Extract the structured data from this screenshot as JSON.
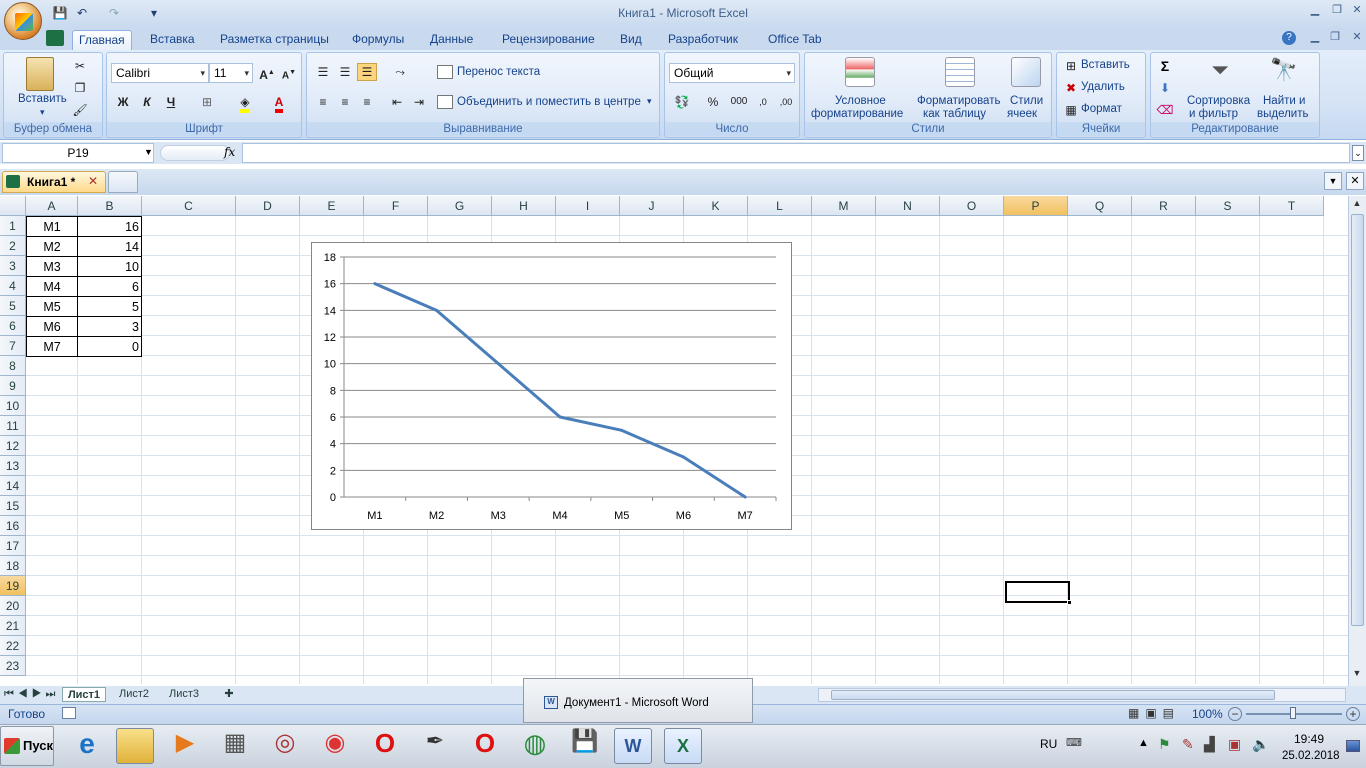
{
  "window": {
    "title": "Книга1 - Microsoft Excel"
  },
  "tabs": [
    "Главная",
    "Вставка",
    "Разметка страницы",
    "Формулы",
    "Данные",
    "Рецензирование",
    "Вид",
    "Разработчик",
    "Office Tab"
  ],
  "ribbon": {
    "clipboard": {
      "label": "Буфер обмена",
      "paste": "Вставить"
    },
    "font": {
      "label": "Шрифт",
      "name": "Calibri",
      "size": "11",
      "bold": "Ж",
      "italic": "К",
      "underline": "Ч"
    },
    "alignment": {
      "label": "Выравнивание",
      "wrap": "Перенос текста",
      "merge": "Объединить и поместить в центре"
    },
    "number": {
      "label": "Число",
      "format": "Общий",
      "percent": "%",
      "thousands": "000",
      "inc_dec": ",0",
      "dec_dec": ",00"
    },
    "styles": {
      "label": "Стили",
      "conditional_1": "Условное",
      "conditional_2": "форматирование",
      "table_1": "Форматировать",
      "table_2": "как таблицу",
      "cell_1": "Стили",
      "cell_2": "ячеек"
    },
    "cells": {
      "label": "Ячейки",
      "insert": "Вставить",
      "delete": "Удалить",
      "format": "Формат"
    },
    "editing": {
      "label": "Редактирование",
      "sort_1": "Сортировка",
      "sort_2": "и фильтр",
      "find_1": "Найти и",
      "find_2": "выделить",
      "sigma": "Σ"
    }
  },
  "formula_bar": {
    "name_box": "P19",
    "fx": "fx",
    "value": ""
  },
  "doc_tab": {
    "label": "Книга1 *"
  },
  "columns": [
    "A",
    "B",
    "C",
    "D",
    "E",
    "F",
    "G",
    "H",
    "I",
    "J",
    "K",
    "L",
    "M",
    "N",
    "O",
    "P",
    "Q",
    "R",
    "S",
    "T"
  ],
  "rows": [
    "1",
    "2",
    "3",
    "4",
    "5",
    "6",
    "7",
    "8",
    "9",
    "10",
    "11",
    "12",
    "13",
    "14",
    "15",
    "16",
    "17",
    "18",
    "19",
    "20",
    "21",
    "22",
    "23"
  ],
  "table": [
    {
      "a": "M1",
      "b": "16"
    },
    {
      "a": "M2",
      "b": "14"
    },
    {
      "a": "M3",
      "b": "10"
    },
    {
      "a": "M4",
      "b": "6"
    },
    {
      "a": "M5",
      "b": "5"
    },
    {
      "a": "M6",
      "b": "3"
    },
    {
      "a": "M7",
      "b": "0"
    }
  ],
  "chart_data": {
    "type": "line",
    "categories": [
      "M1",
      "M2",
      "M3",
      "M4",
      "M5",
      "M6",
      "M7"
    ],
    "series": [
      {
        "values": [
          16,
          14,
          10,
          6,
          5,
          3,
          0
        ],
        "color": "#4a7ebb"
      }
    ],
    "ylim": [
      0,
      18
    ],
    "yticks": [
      "0",
      "2",
      "4",
      "6",
      "8",
      "10",
      "12",
      "14",
      "16",
      "18"
    ],
    "grid": true,
    "legend": "none"
  },
  "sheets": [
    "Лист1",
    "Лист2",
    "Лист3"
  ],
  "status": {
    "ready": "Готово",
    "zoom": "100%"
  },
  "taskbar": {
    "start": "Пуск",
    "popup": "Документ1 - Microsoft Word",
    "lang": "RU",
    "time": "19:49",
    "date": "25.02.2018"
  }
}
